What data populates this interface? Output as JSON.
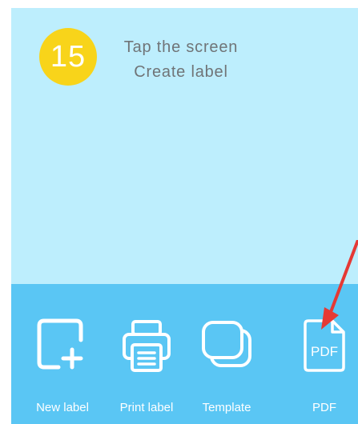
{
  "step_badge": "15",
  "hint": {
    "line1": "Tap the screen",
    "line2": "Create label"
  },
  "toolbar": {
    "items": [
      {
        "label": "New label",
        "icon": "new-label-icon"
      },
      {
        "label": "Print label",
        "icon": "printer-icon"
      },
      {
        "label": "Template",
        "icon": "template-icon"
      },
      {
        "label": "PDF",
        "icon": "pdf-icon",
        "icon_text": "PDF"
      }
    ]
  },
  "colors": {
    "canvas_bg": "#bdeefd",
    "toolbar_bg": "#5ac6f4",
    "badge": "#f8d41a",
    "arrow": "#e53935",
    "hint_text": "#707477"
  }
}
